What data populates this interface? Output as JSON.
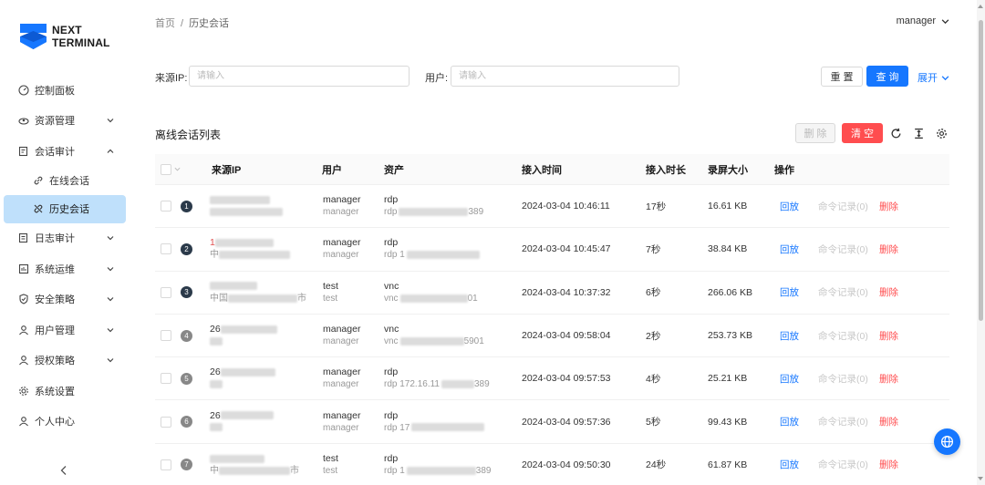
{
  "app": {
    "logo_line1": "NEXT",
    "logo_line2": "TERMINAL"
  },
  "sidebar": {
    "items": [
      {
        "label": "控制面板",
        "icon": "dashboard-icon",
        "expandable": false
      },
      {
        "label": "资源管理",
        "icon": "cloud-icon",
        "expandable": true
      },
      {
        "label": "会话审计",
        "icon": "audit-icon",
        "expandable": true,
        "expanded": true
      },
      {
        "label": "在线会话",
        "icon": "link-icon",
        "sub": true
      },
      {
        "label": "历史会话",
        "icon": "link-off-icon",
        "sub": true,
        "active": true
      },
      {
        "label": "日志审计",
        "icon": "log-icon",
        "expandable": true
      },
      {
        "label": "系统运维",
        "icon": "ops-icon",
        "expandable": true
      },
      {
        "label": "安全策略",
        "icon": "shield-icon",
        "expandable": true
      },
      {
        "label": "用户管理",
        "icon": "user-icon",
        "expandable": true
      },
      {
        "label": "授权策略",
        "icon": "user-icon",
        "expandable": true
      },
      {
        "label": "系统设置",
        "icon": "gear-icon",
        "expandable": false
      },
      {
        "label": "个人中心",
        "icon": "user-icon",
        "expandable": false
      }
    ]
  },
  "header": {
    "breadcrumb_home": "首页",
    "breadcrumb_sep": "/",
    "breadcrumb_current": "历史会话",
    "user": "manager"
  },
  "filters": {
    "source_ip_label": "来源IP:",
    "source_ip_placeholder": "请输入",
    "user_label": "用户:",
    "user_placeholder": "请输入",
    "reset_label": "重 置",
    "query_label": "查 询",
    "expand_label": "展开"
  },
  "list": {
    "title": "离线会话列表",
    "delete_label": "删 除",
    "clear_label": "清 空"
  },
  "table": {
    "columns": [
      "来源IP",
      "用户",
      "资产",
      "接入时间",
      "接入时长",
      "录屏大小",
      "操作"
    ],
    "actions": {
      "replay": "回放",
      "commands": "命令记录(0)",
      "delete": "删除"
    },
    "rows": [
      {
        "index": "1",
        "ip_visible": "",
        "ip_tail": "",
        "user1": "manager",
        "user2": "manager",
        "asset_proto": "rdp",
        "asset_sub": "rdp",
        "asset_tail": "389",
        "time": "2024-03-04 10:46:11",
        "duration": "17秒",
        "size": "16.61 KB"
      },
      {
        "index": "2",
        "ip_visible": "1",
        "ip_tail": "中",
        "user1": "manager",
        "user2": "manager",
        "asset_proto": "rdp",
        "asset_sub": "rdp 1",
        "asset_tail": "",
        "time": "2024-03-04 10:45:47",
        "duration": "7秒",
        "size": "38.84 KB"
      },
      {
        "index": "3",
        "ip_visible": "",
        "ip_tail": "中国",
        "ip_tail2": "市",
        "user1": "test",
        "user2": "test",
        "asset_proto": "vnc",
        "asset_sub": "vnc",
        "asset_tail": "01",
        "time": "2024-03-04 10:37:32",
        "duration": "6秒",
        "size": "266.06 KB"
      },
      {
        "index": "4",
        "ip_visible": "26",
        "ip_tail": "",
        "user1": "manager",
        "user2": "manager",
        "asset_proto": "vnc",
        "asset_sub": "vnc",
        "asset_tail": "5901",
        "time": "2024-03-04 09:58:04",
        "duration": "2秒",
        "size": "253.73 KB"
      },
      {
        "index": "5",
        "ip_visible": "26",
        "ip_tail": "",
        "user1": "manager",
        "user2": "manager",
        "asset_proto": "rdp",
        "asset_sub": "rdp 172.16.11",
        "asset_tail": "389",
        "time": "2024-03-04 09:57:53",
        "duration": "4秒",
        "size": "25.21 KB"
      },
      {
        "index": "6",
        "ip_visible": "26",
        "ip_tail": "",
        "user1": "manager",
        "user2": "manager",
        "asset_proto": "rdp",
        "asset_sub": "rdp 17",
        "asset_tail": "",
        "time": "2024-03-04 09:57:36",
        "duration": "5秒",
        "size": "99.43 KB"
      },
      {
        "index": "7",
        "ip_visible": "",
        "ip_tail": "中",
        "ip_tail2": "市",
        "user1": "test",
        "user2": "test",
        "asset_proto": "rdp",
        "asset_sub": "rdp 1",
        "asset_tail": "389",
        "time": "2024-03-04 09:50:30",
        "duration": "24秒",
        "size": "61.87 KB"
      }
    ]
  },
  "colors": {
    "primary": "#1677ff",
    "danger": "#ff4d4f",
    "active_bg": "#bfe0fb",
    "logo_blue": "#1677ff"
  }
}
